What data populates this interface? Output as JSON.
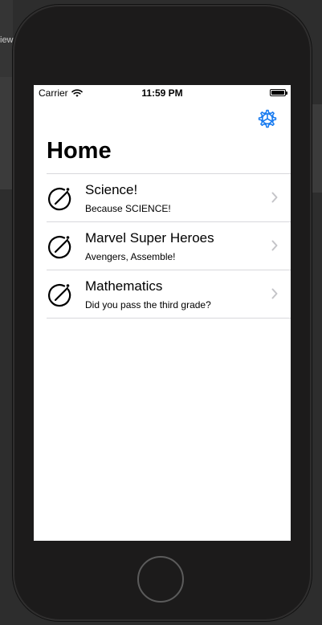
{
  "background": {
    "partial_label": "iew"
  },
  "status_bar": {
    "carrier": "Carrier",
    "time": "11:59 PM",
    "battery_level": 1.0
  },
  "nav": {
    "title": "Home",
    "settings_icon": "gear-icon",
    "accent_color": "#1a7cf0"
  },
  "topics": [
    {
      "title": "Science!",
      "subtitle": "Because SCIENCE!",
      "icon": "quiz-icon"
    },
    {
      "title": "Marvel Super Heroes",
      "subtitle": "Avengers, Assemble!",
      "icon": "quiz-icon"
    },
    {
      "title": "Mathematics",
      "subtitle": "Did you pass the third grade?",
      "icon": "quiz-icon"
    }
  ]
}
